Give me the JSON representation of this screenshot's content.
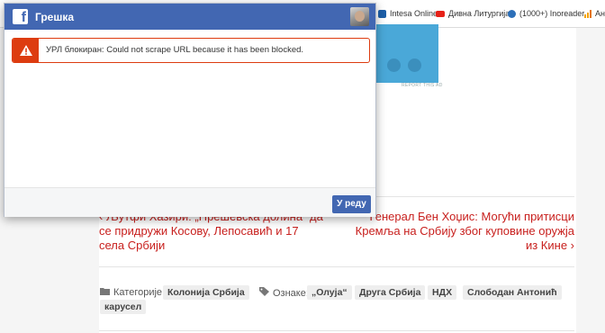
{
  "bookmarks": [
    {
      "label": "Intesa Online",
      "icon": "intesa-icon",
      "color": "#1d5fa8"
    },
    {
      "label": "Дивна Литургија",
      "icon": "youtube-icon",
      "color": "#e62117"
    },
    {
      "label": "(1000+) Inoreader",
      "icon": "inoreader-icon",
      "color": "#2c6fb8"
    },
    {
      "label": "Ана",
      "icon": "analytics-icon",
      "color": "#f4a100"
    }
  ],
  "dialog": {
    "title": "Грешка",
    "error_message": "УРЛ блокиран: Could not scrape URL because it has been blocked.",
    "ok_label": "У реду"
  },
  "page": {
    "ad_report": "REPORT THIS AD",
    "prev_post": {
      "line1": "‹ Љутфи Хазири: „Прешевска долина“ да",
      "line2": "се придружи Косову, Лепосавић и 17",
      "line3": "села Србији"
    },
    "next_post": {
      "line1": "Генерал Бен Хоџис: Могући притисци",
      "line2": "Кремља на Србију због куповине оружја",
      "line3": "из Кине ›"
    },
    "categories_label": "Категорије:",
    "categories": [
      "Колонија Србија"
    ],
    "tags_label": "Ознаке:",
    "tags": [
      "„Олуја“",
      "Друга Србија",
      "НДХ",
      "Слободан Антонић",
      "карусел"
    ]
  },
  "colors": {
    "facebook_blue": "#4267b2",
    "error_red": "#dd3c10",
    "link_red": "#c8201e"
  }
}
